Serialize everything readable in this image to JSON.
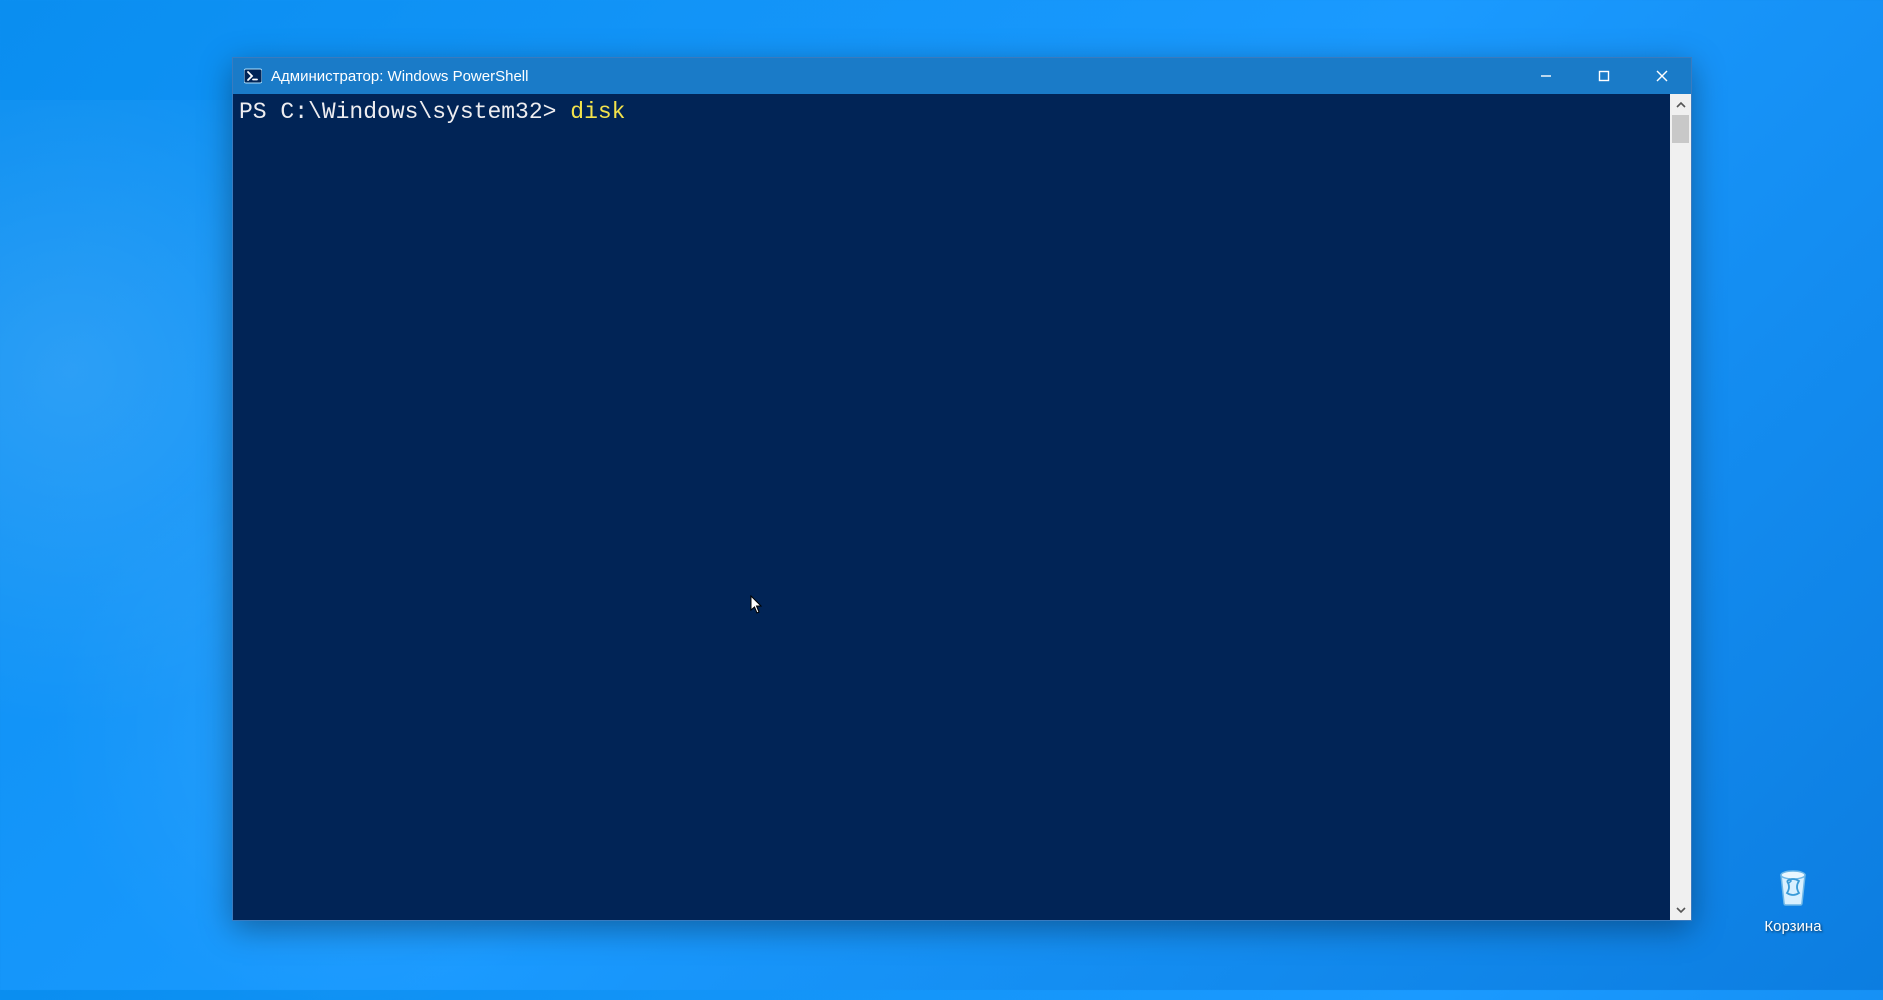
{
  "window": {
    "title": "Администратор: Windows PowerShell"
  },
  "terminal": {
    "prompt": "PS C:\\Windows\\system32> ",
    "command": "disk"
  },
  "desktop": {
    "recycle_bin_label": "Корзина"
  }
}
